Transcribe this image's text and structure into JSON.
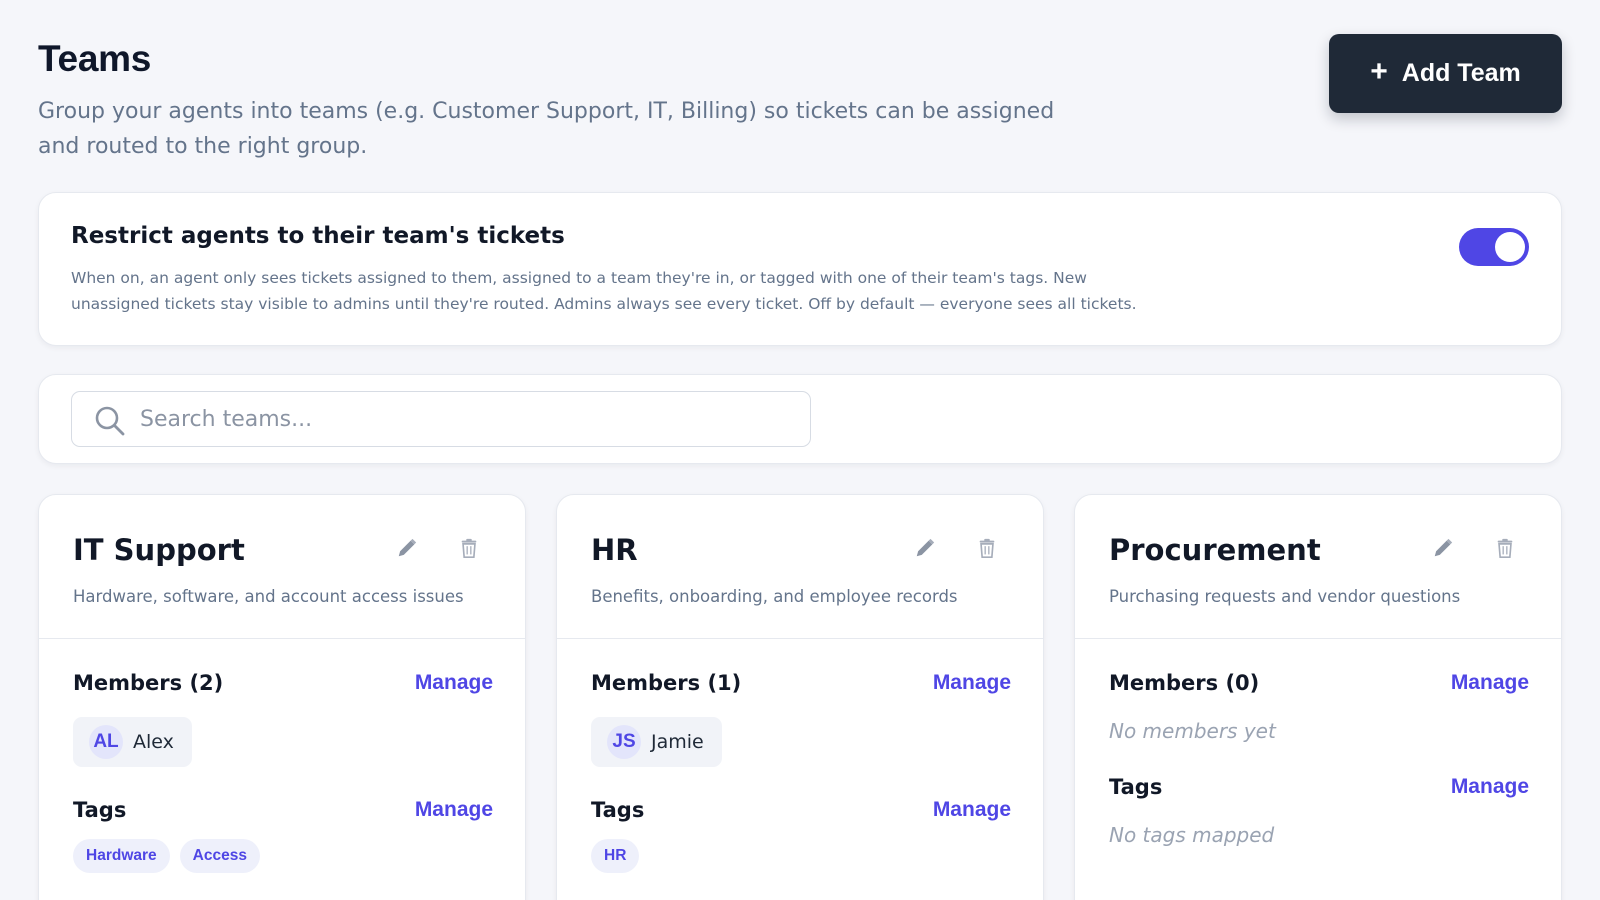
{
  "header": {
    "title": "Teams",
    "subtitle": "Group your agents into teams (e.g. Customer Support, IT, Billing) so tickets can be assigned and routed to the right group.",
    "add_button_label": "Add Team",
    "add_button_icon": "plus-icon"
  },
  "restrict": {
    "title": "Restrict agents to their team's tickets",
    "description": "When on, an agent only sees tickets assigned to them, assigned to a team they're in, or tagged with one of their team's tags. New unassigned tickets stay visible to admins until they're routed. Admins always see every ticket. Off by default — everyone sees all tickets.",
    "enabled": true
  },
  "search": {
    "placeholder": "Search teams...",
    "value": ""
  },
  "teams": [
    {
      "name": "IT Support",
      "description": "Hardware, software, and account access issues",
      "members_label": "Members (2)",
      "members_manage": "Manage",
      "members": [
        {
          "initials": "AL",
          "name": "Alex"
        }
      ],
      "tags_label": "Tags",
      "tags_manage": "Manage",
      "tags": [
        "Hardware",
        "Access"
      ]
    },
    {
      "name": "HR",
      "description": "Benefits, onboarding, and employee records",
      "members_label": "Members (1)",
      "members_manage": "Manage",
      "members": [
        {
          "initials": "JS",
          "name": "Jamie"
        }
      ],
      "tags_label": "Tags",
      "tags_manage": "Manage",
      "tags": [
        "HR"
      ]
    },
    {
      "name": "Procurement",
      "description": "Purchasing requests and vendor questions",
      "members_label": "Members (0)",
      "members_manage": "Manage",
      "members_empty": "No members yet",
      "tags_label": "Tags",
      "tags_manage": "Manage",
      "tags_empty": "No tags mapped"
    }
  ],
  "colors": {
    "accent": "#4f46e5",
    "primary_button": "#1f2937",
    "background": "#f5f6fa"
  }
}
